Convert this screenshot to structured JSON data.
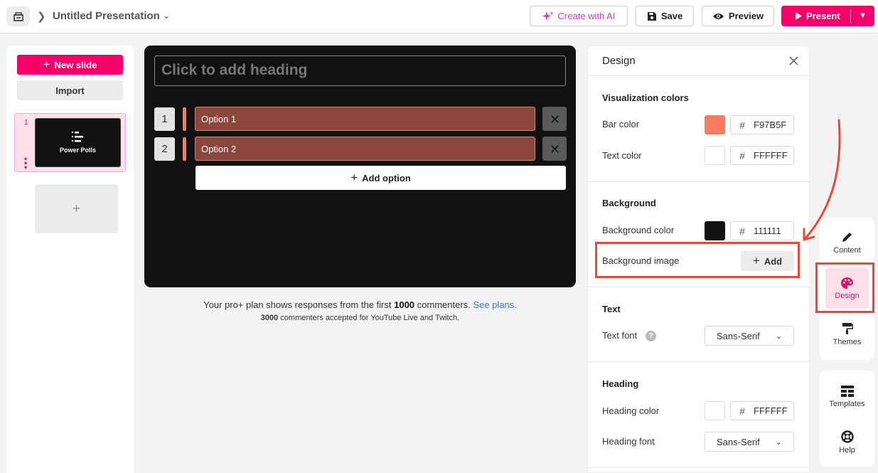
{
  "topbar": {
    "title": "Untitled Presentation",
    "create_ai_label": "Create with AI",
    "save_label": "Save",
    "preview_label": "Preview",
    "present_label": "Present"
  },
  "left": {
    "new_slide_label": "New slide",
    "import_label": "Import",
    "slides": [
      {
        "number": "1",
        "title": "Power Polls"
      }
    ],
    "add_slide_symbol": "+"
  },
  "canvas": {
    "heading_placeholder": "Click to add heading",
    "options": [
      {
        "number": "1",
        "label": "Option 1"
      },
      {
        "number": "2",
        "label": "Option 2"
      }
    ],
    "add_option_label": "Add option"
  },
  "plan_note": {
    "prefix": "Your pro+ plan shows responses from the first",
    "count": "1000",
    "suffix": "commenters.",
    "link": "See plans.",
    "sub_count": "3000",
    "sub_text": "commenters accepted for YouTube Live and Twitch."
  },
  "design": {
    "title": "Design",
    "visualization": {
      "heading": "Visualization colors",
      "bar_color_label": "Bar color",
      "bar_color": "F97B5F",
      "text_color_label": "Text color",
      "text_color": "FFFFFF"
    },
    "background": {
      "heading": "Background",
      "color_label": "Background color",
      "color": "111111",
      "image_label": "Background image",
      "add_label": "Add"
    },
    "text": {
      "heading": "Text",
      "font_label": "Text font",
      "font_value": "Sans-Serif"
    },
    "heading_section": {
      "heading": "Heading",
      "color_label": "Heading color",
      "color": "FFFFFF",
      "font_label": "Heading font",
      "font_value": "Sans-Serif"
    }
  },
  "rail": {
    "content": "Content",
    "design": "Design",
    "themes": "Themes",
    "templates": "Templates",
    "help": "Help"
  },
  "colors": {
    "accent": "#f5006b",
    "bar": "#f97b5f",
    "annotation": "#e8483a"
  }
}
